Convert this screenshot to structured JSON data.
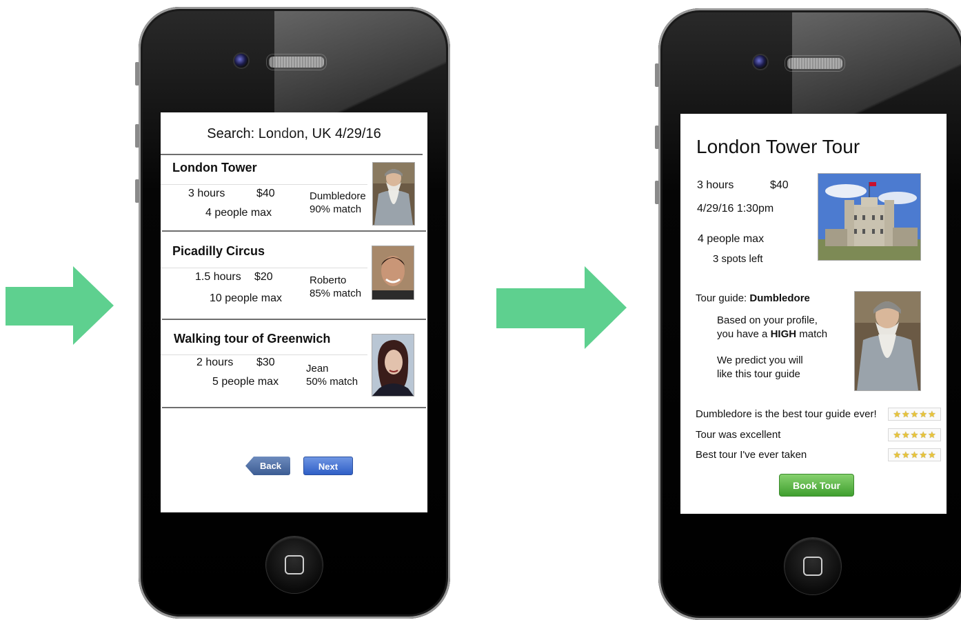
{
  "colors": {
    "arrow": "#5ed08f",
    "back_button": "#4a6aa0",
    "next_button": "#3f6fd6",
    "book_button": "#5bb946"
  },
  "screen1": {
    "title": "Search: London, UK 4/29/16",
    "results": [
      {
        "title": "London Tower",
        "duration": "3 hours",
        "price": "$40",
        "capacity": "4 people max",
        "guide": "Dumbledore",
        "match": "90% match",
        "photo": "dumbledore-photo"
      },
      {
        "title": "Picadilly Circus",
        "duration": "1.5 hours",
        "price": "$20",
        "capacity": "10 people max",
        "guide": "Roberto",
        "match": "85% match",
        "photo": "roberto-photo"
      },
      {
        "title": "Walking tour of Greenwich",
        "duration": "2 hours",
        "price": "$30",
        "capacity": "5 people max",
        "guide": "Jean",
        "match": "50% match",
        "photo": "jean-photo"
      }
    ],
    "back_label": "Back",
    "next_label": "Next"
  },
  "screen2": {
    "title": "London Tower Tour",
    "duration": "3 hours",
    "price": "$40",
    "datetime": "4/29/16 1:30pm",
    "capacity": "4 people max",
    "spots_left": "3 spots left",
    "guide_prefix": "Tour guide: ",
    "guide_name": "Dumbledore",
    "match_line1": "Based on your profile,",
    "match_line2_pre": "you have a ",
    "match_level": "HIGH",
    "match_line2_post": " match",
    "predict_line1": "We predict you will",
    "predict_line2": "like this tour guide",
    "reviews": [
      {
        "text": "Dumbledore is the best tour guide ever!",
        "stars": 5
      },
      {
        "text": "Tour was excellent",
        "stars": 5
      },
      {
        "text": "Best tour I've ever taken",
        "stars": 5
      }
    ],
    "book_label": "Book Tour"
  }
}
